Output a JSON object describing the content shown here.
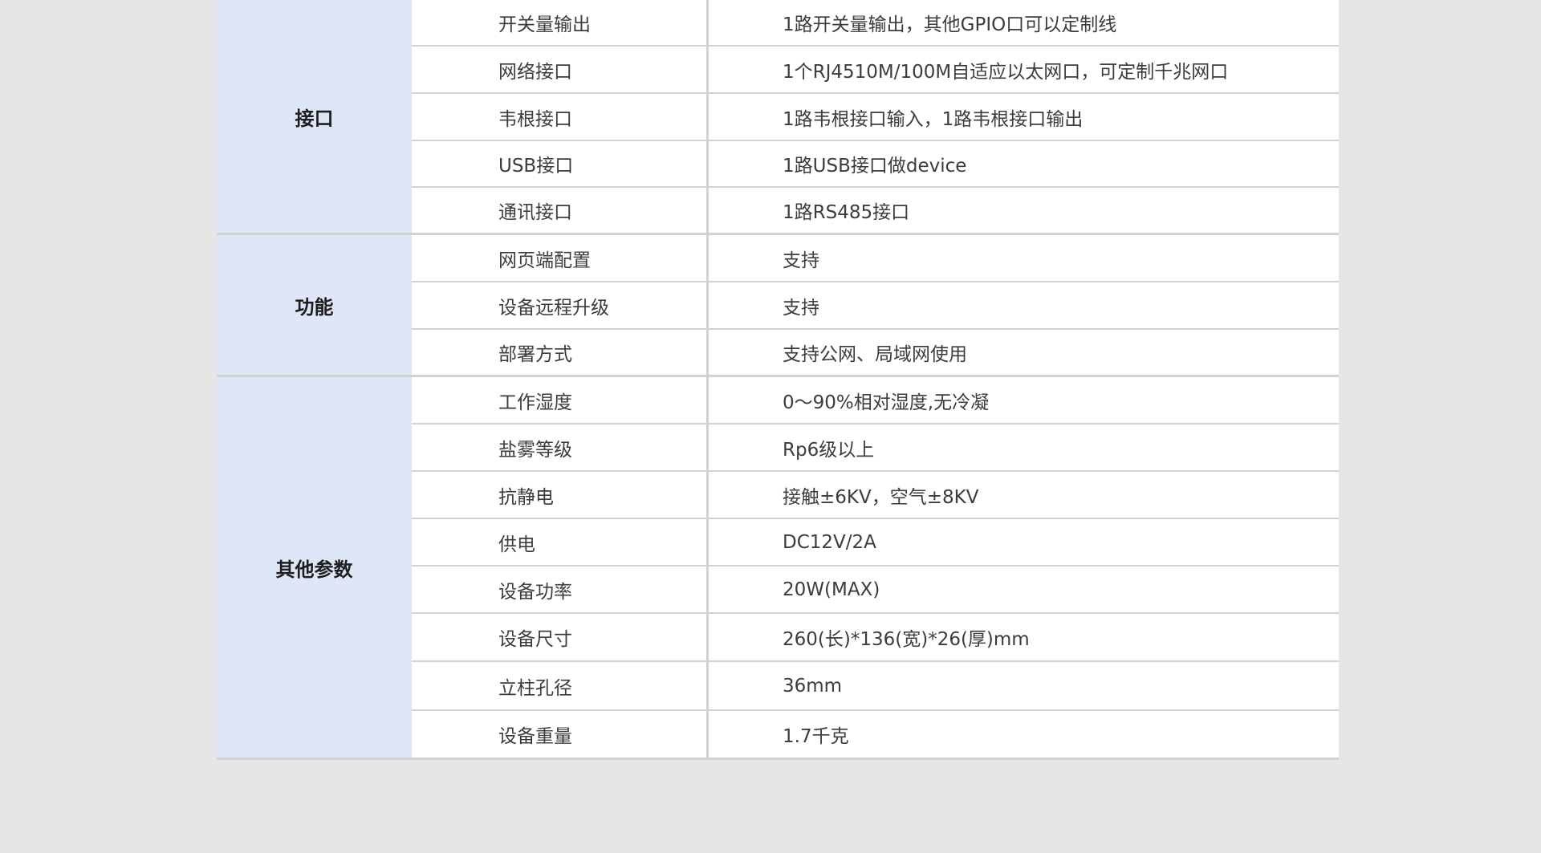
{
  "groups": [
    {
      "label": "接口",
      "rows": [
        {
          "key": "开关量输出",
          "value": "1路开关量输出，其他GPIO口可以定制线"
        },
        {
          "key": "网络接口",
          "value": "1个RJ4510M/100M自适应以太网口，可定制千兆网口"
        },
        {
          "key": "韦根接口",
          "value": "1路韦根接口输入，1路韦根接口输出"
        },
        {
          "key": "USB接口",
          "value": "1路USB接口做device"
        },
        {
          "key": "通讯接口",
          "value": "1路RS485接口"
        }
      ]
    },
    {
      "label": "功能",
      "rows": [
        {
          "key": "网页端配置",
          "value": "支持"
        },
        {
          "key": "设备远程升级",
          "value": "支持"
        },
        {
          "key": "部署方式",
          "value": "支持公网、局域网使用"
        }
      ]
    },
    {
      "label": "其他参数",
      "rows": [
        {
          "key": "工作湿度",
          "value": "0～90%相对湿度,无冷凝"
        },
        {
          "key": "盐雾等级",
          "value": "Rp6级以上"
        },
        {
          "key": "抗静电",
          "value": "接触±6KV，空气±8KV"
        },
        {
          "key": "供电",
          "value": "DC12V/2A"
        },
        {
          "key": "设备功率",
          "value": "20W(MAX)"
        },
        {
          "key": "设备尺寸",
          "value": "260(长)*136(宽)*26(厚)mm"
        },
        {
          "key": "立柱孔径",
          "value": "36mm"
        },
        {
          "key": "设备重量",
          "value": "1.7千克"
        }
      ]
    }
  ]
}
